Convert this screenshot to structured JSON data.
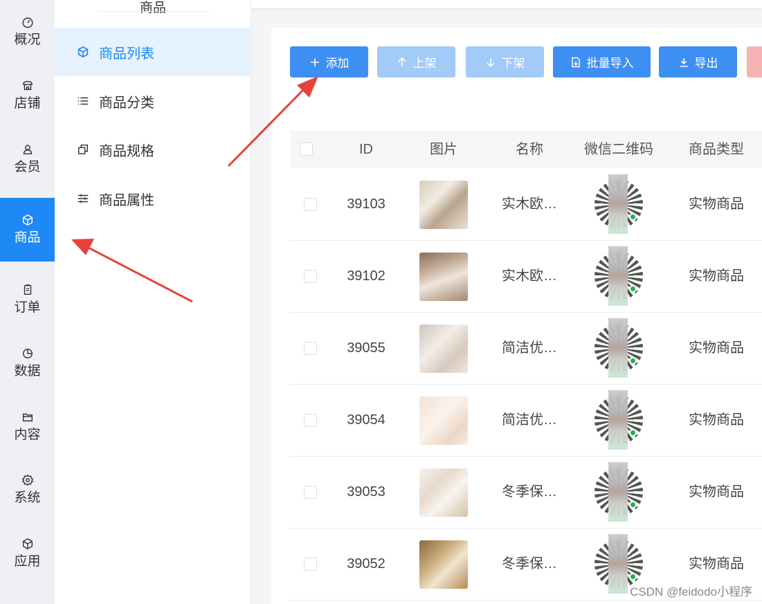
{
  "rail": {
    "items": [
      {
        "label": "概况",
        "icon": "dashboard-icon"
      },
      {
        "label": "店铺",
        "icon": "store-icon"
      },
      {
        "label": "会员",
        "icon": "user-icon"
      },
      {
        "label": "商品",
        "icon": "box-icon"
      },
      {
        "label": "订单",
        "icon": "clipboard-icon"
      },
      {
        "label": "数据",
        "icon": "pie-chart-icon"
      },
      {
        "label": "内容",
        "icon": "folder-icon"
      },
      {
        "label": "系统",
        "icon": "gear-icon"
      },
      {
        "label": "应用",
        "icon": "cube-icon"
      }
    ]
  },
  "subnav": {
    "title": "商品",
    "items": [
      {
        "label": "商品列表",
        "icon": "box-icon"
      },
      {
        "label": "商品分类",
        "icon": "list-icon"
      },
      {
        "label": "商品规格",
        "icon": "copy-icon"
      },
      {
        "label": "商品属性",
        "icon": "sliders-icon"
      }
    ]
  },
  "toolbar": {
    "add": "添加",
    "up": "上架",
    "down": "下架",
    "import": "批量导入",
    "export": "导出"
  },
  "table": {
    "headers": [
      "ID",
      "图片",
      "名称",
      "微信二维码",
      "商品类型"
    ],
    "rows": [
      {
        "id": "39103",
        "name": "实木欧…",
        "type": "实物商品"
      },
      {
        "id": "39102",
        "name": "实木欧…",
        "type": "实物商品"
      },
      {
        "id": "39055",
        "name": "简洁优…",
        "type": "实物商品"
      },
      {
        "id": "39054",
        "name": "简洁优…",
        "type": "实物商品"
      },
      {
        "id": "39053",
        "name": "冬季保…",
        "type": "实物商品"
      },
      {
        "id": "39052",
        "name": "冬季保…",
        "type": "实物商品"
      }
    ]
  },
  "watermark": "CSDN @feidodo小程序",
  "colors": {
    "accent": "#1e88f5",
    "primary_button": "#3d8ff3",
    "annotation_arrow": "#e8413b"
  }
}
